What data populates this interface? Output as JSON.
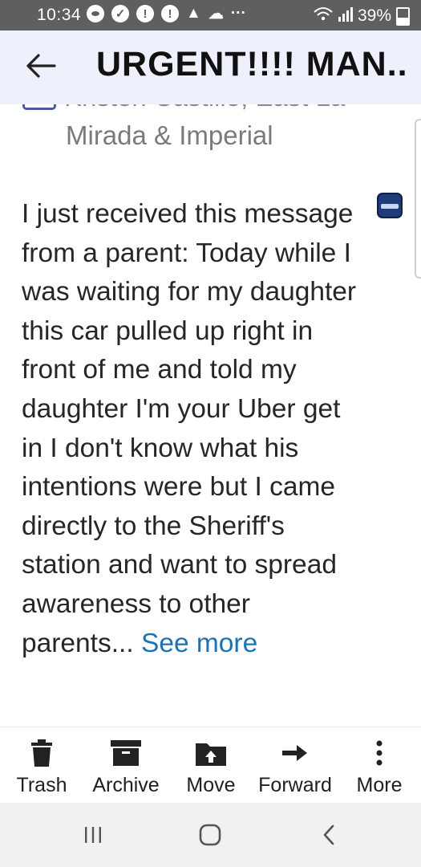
{
  "status_bar": {
    "time": "10:34",
    "more": "···",
    "battery": "39%"
  },
  "app_bar": {
    "title": "URGENT!!!! MAN",
    "title_ellipsis": "..."
  },
  "sender": {
    "cut_line": "Kristen Castillo, East La",
    "location": "Mirada & Imperial"
  },
  "message": {
    "text": "I just received this message from a parent: Today while I was waiting for my daughter this car pulled up right in front of me and told my daughter I'm your Uber get in I don't know what his intentions were but I came directly to the Sheriff's station and want to spread awareness to other parents...",
    "see_more": "See more"
  },
  "actions": [
    {
      "label": "Trash",
      "icon": "trash-icon"
    },
    {
      "label": "Archive",
      "icon": "archive-icon"
    },
    {
      "label": "Move",
      "icon": "move-folder-icon"
    },
    {
      "label": "Forward",
      "icon": "forward-arrow-icon"
    },
    {
      "label": "More",
      "icon": "more-vertical-icon"
    }
  ],
  "colors": {
    "status_bar": "#5f5f5f",
    "app_bar": "#eef0fb",
    "link": "#1a73b5",
    "nav_bar": "#f1f1f1"
  }
}
